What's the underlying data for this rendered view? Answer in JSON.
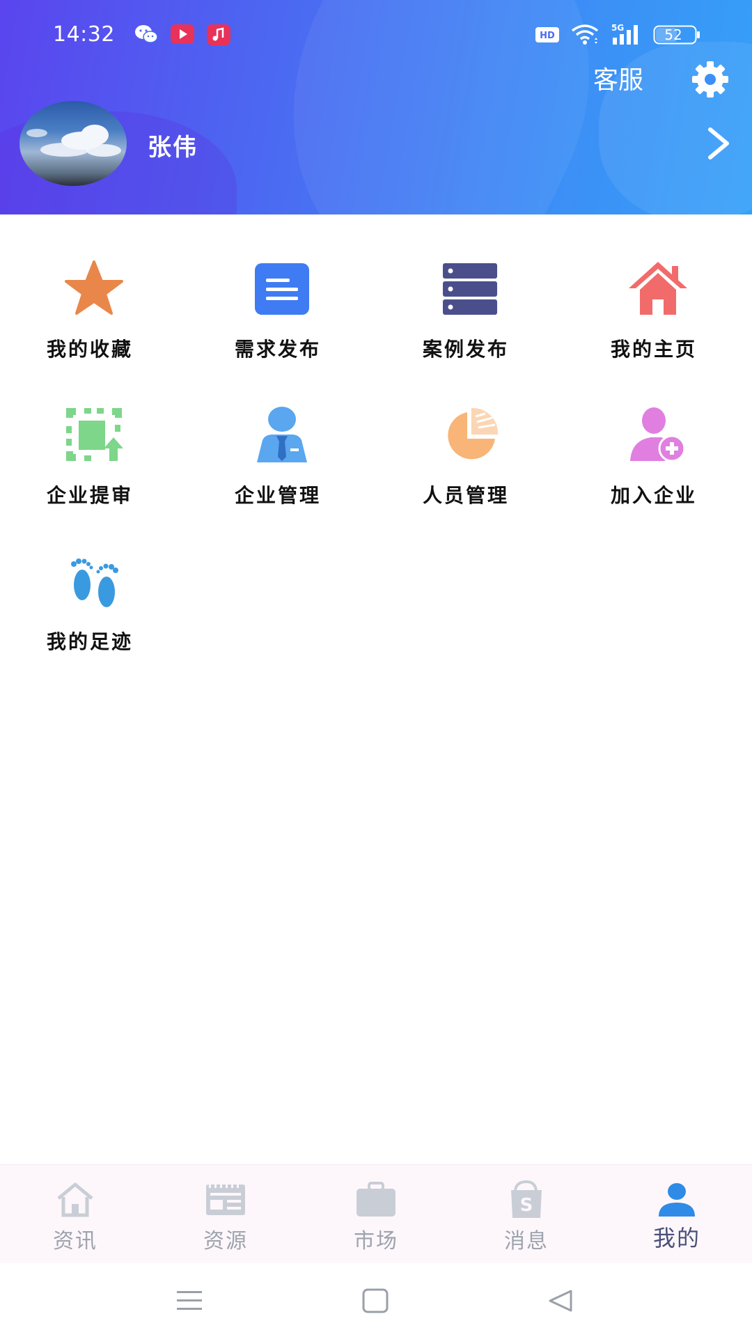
{
  "status_bar": {
    "time": "14:32",
    "battery": "52",
    "hd": "HD",
    "network": "5G"
  },
  "header": {
    "service_label": "客服",
    "username": "张伟",
    "icons": [
      "settings-gear-icon",
      "chevron-right-icon"
    ]
  },
  "menu": {
    "items": [
      {
        "label": "我的收藏",
        "icon": "star-icon",
        "color": "#E9874A"
      },
      {
        "label": "需求发布",
        "icon": "document-lines-icon",
        "color": "#3F7BF3"
      },
      {
        "label": "案例发布",
        "icon": "server-stack-icon",
        "color": "#4A4F8C"
      },
      {
        "label": "我的主页",
        "icon": "house-icon",
        "color": "#F26B6B"
      },
      {
        "label": "企业提审",
        "icon": "upload-frame-icon",
        "color": "#7DD68A"
      },
      {
        "label": "企业管理",
        "icon": "businessman-icon",
        "color": "#5AA6EF"
      },
      {
        "label": "人员管理",
        "icon": "pie-chart-icon",
        "color": "#F8B577"
      },
      {
        "label": "加入企业",
        "icon": "user-add-icon",
        "color": "#E07FE0"
      },
      {
        "label": "我的足迹",
        "icon": "footprints-icon",
        "color": "#3A9AE0"
      }
    ]
  },
  "tabbar": {
    "active_color": "#2F8BE6",
    "inactive_color": "#C9CED6",
    "tabs": [
      {
        "label": "资讯",
        "icon": "home-outline-icon",
        "active": false
      },
      {
        "label": "资源",
        "icon": "newspaper-icon",
        "active": false
      },
      {
        "label": "市场",
        "icon": "briefcase-icon",
        "active": false
      },
      {
        "label": "消息",
        "icon": "shopping-bag-icon",
        "active": false
      },
      {
        "label": "我的",
        "icon": "person-icon",
        "active": true
      }
    ]
  },
  "nav_bar": {
    "buttons": [
      "menu-icon",
      "home-square-icon",
      "back-triangle-icon"
    ]
  }
}
